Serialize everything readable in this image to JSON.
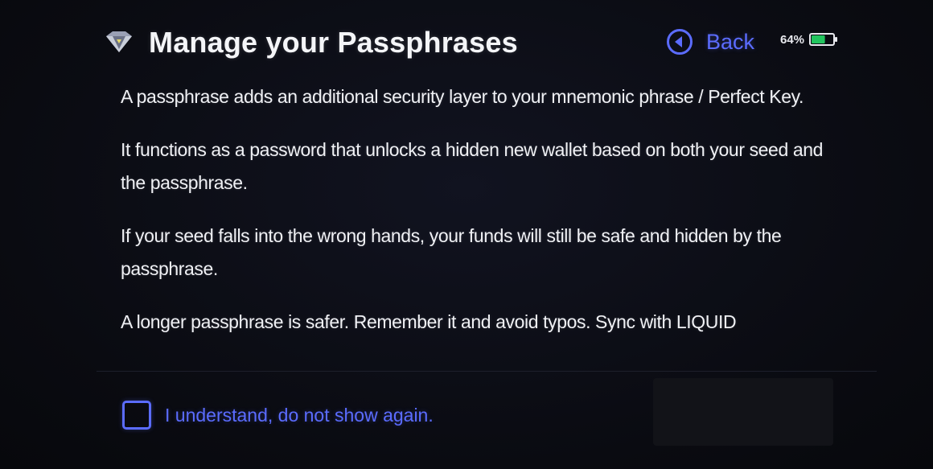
{
  "header": {
    "title": "Manage your Passphrases",
    "logo_icon": "diamond-logo-icon",
    "back_label": "Back",
    "back_icon": "circle-arrow-left-icon",
    "battery_percent": "64%",
    "battery_icon": "battery-icon",
    "battery_level": 0.64
  },
  "body": {
    "paragraphs": [
      "A passphrase adds an additional security layer to your mnemonic phrase / Perfect Key.",
      "It functions as a password that unlocks a hidden new wallet based on both your seed and the passphrase.",
      "If your seed falls into the wrong hands, your funds will still be safe and hidden by the passphrase.",
      "A longer passphrase is safer. Remember it and avoid typos. Sync with LIQUID"
    ]
  },
  "footer": {
    "checkbox_label": "I understand, do not show again.",
    "checked": false
  },
  "colors": {
    "accent": "#5b6cff",
    "battery": "#22c55e",
    "background": "#0b0c12",
    "text": "#f0f1f5"
  }
}
